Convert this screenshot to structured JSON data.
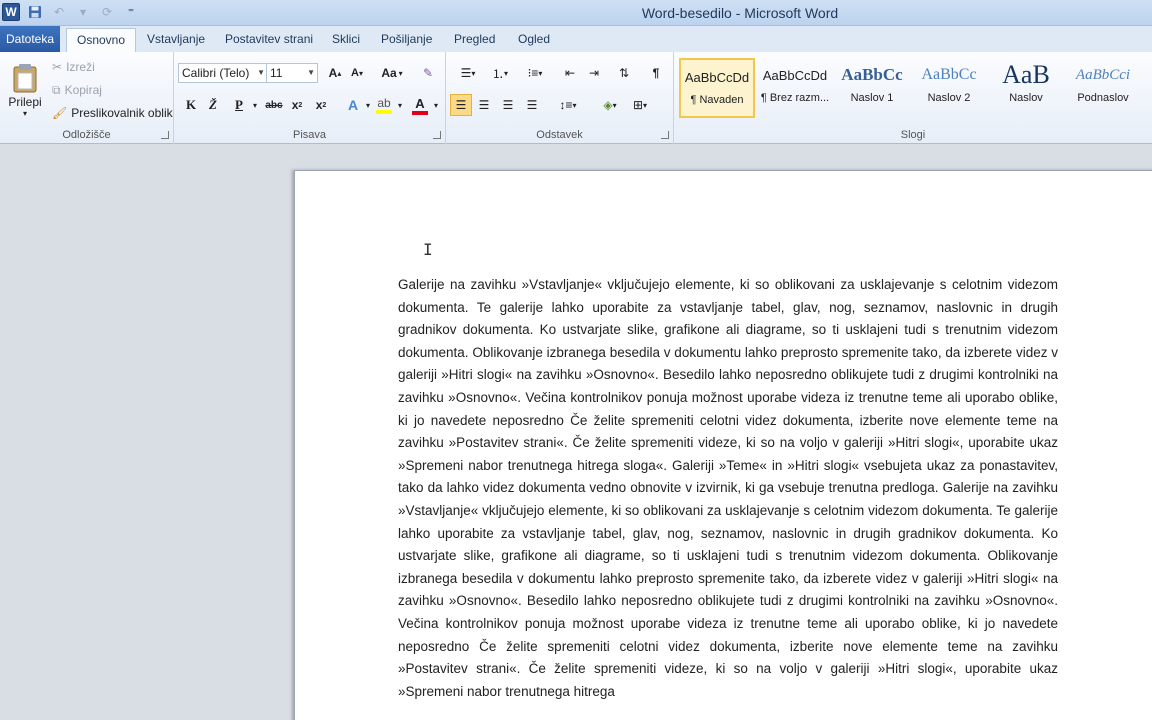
{
  "window": {
    "title": "Word-besedilo - Microsoft Word"
  },
  "quick_access": {
    "app_icon_letter": "W"
  },
  "tabs": [
    {
      "label": "Datoteka"
    },
    {
      "label": "Osnovno"
    },
    {
      "label": "Vstavljanje"
    },
    {
      "label": "Postavitev strani"
    },
    {
      "label": "Sklici"
    },
    {
      "label": "Pošiljanje"
    },
    {
      "label": "Pregled"
    },
    {
      "label": "Ogled"
    }
  ],
  "clipboard": {
    "paste_label": "Prilepi",
    "cut_label": "Izreži",
    "copy_label": "Kopiraj",
    "format_painter_label": "Preslikovalnik oblik",
    "group_label": "Odložišče"
  },
  "font": {
    "font_name": "Calibri (Telo)",
    "font_size": "11",
    "grow_label": "A",
    "shrink_label": "A",
    "case_label": "Aa",
    "bold_label": "K",
    "italic_label": "Ž",
    "underline_label": "P",
    "strike_label": "abc",
    "subscript_label": "x",
    "superscript_label": "x",
    "text_effects_label": "A",
    "font_color_label": "A",
    "group_label": "Pisava"
  },
  "paragraph": {
    "group_label": "Odstavek"
  },
  "styles": {
    "group_label": "Slogi",
    "items": [
      {
        "sample": "AaBbCcDd",
        "name": "¶ Navaden"
      },
      {
        "sample": "AaBbCcDd",
        "name": "¶ Brez razm..."
      },
      {
        "sample": "AaBbCc",
        "name": "Naslov 1"
      },
      {
        "sample": "AaBbCc",
        "name": "Naslov 2"
      },
      {
        "sample": "AaB",
        "name": "Naslov"
      },
      {
        "sample": "AaBbCci",
        "name": "Podnaslov"
      }
    ]
  },
  "colors": {
    "accent": "#2b5797",
    "highlight": "#ffff00",
    "font_color": "#e0001b",
    "selected_style_border": "#f3c84a"
  },
  "document": {
    "cursor_glyph": "I",
    "body": "Galerije na zavihku »Vstavljanje« vključujejo elemente, ki so oblikovani za usklajevanje s celotnim videzom dokumenta. Te galerije lahko uporabite za vstavljanje tabel, glav, nog, seznamov, naslovnic in drugih gradnikov dokumenta. Ko ustvarjate slike, grafikone ali diagrame, so ti usklajeni tudi s trenutnim videzom dokumenta. Oblikovanje izbranega besedila v dokumentu lahko preprosto spremenite tako, da izberete videz v galeriji »Hitri slogi« na zavihku »Osnovno«. Besedilo lahko neposredno oblikujete tudi z drugimi kontrolniki na zavihku »Osnovno«. Večina kontrolnikov ponuja možnost uporabe videza iz trenutne teme ali uporabo oblike, ki jo navedete neposredno Če želite spremeniti celotni videz dokumenta, izberite nove elemente teme na zavihku »Postavitev strani«. Če želite spremeniti videze, ki so na voljo v galeriji »Hitri slogi«, uporabite ukaz »Spremeni nabor trenutnega hitrega sloga«. Galeriji »Teme« in »Hitri slogi« vsebujeta ukaz za ponastavitev, tako da lahko videz dokumenta vedno obnovite v izvirnik, ki ga vsebuje trenutna predloga. Galerije na zavihku »Vstavljanje« vključujejo elemente, ki so oblikovani za usklajevanje s celotnim videzom dokumenta. Te galerije lahko uporabite za vstavljanje tabel, glav, nog, seznamov, naslovnic in drugih gradnikov dokumenta. Ko ustvarjate slike, grafikone ali diagrame, so ti usklajeni tudi s trenutnim videzom dokumenta. Oblikovanje izbranega besedila v dokumentu lahko preprosto spremenite tako, da izberete videz v galeriji »Hitri slogi« na zavihku »Osnovno«. Besedilo lahko neposredno oblikujete tudi z drugimi kontrolniki na zavihku »Osnovno«. Večina kontrolnikov ponuja možnost uporabe videza iz trenutne teme ali uporabo oblike, ki jo navedete neposredno Če želite spremeniti celotni videz dokumenta, izberite nove elemente teme na zavihku »Postavitev strani«. Če želite spremeniti videze, ki so na voljo v galeriji »Hitri slogi«, uporabite ukaz »Spremeni nabor trenutnega hitrega"
  }
}
